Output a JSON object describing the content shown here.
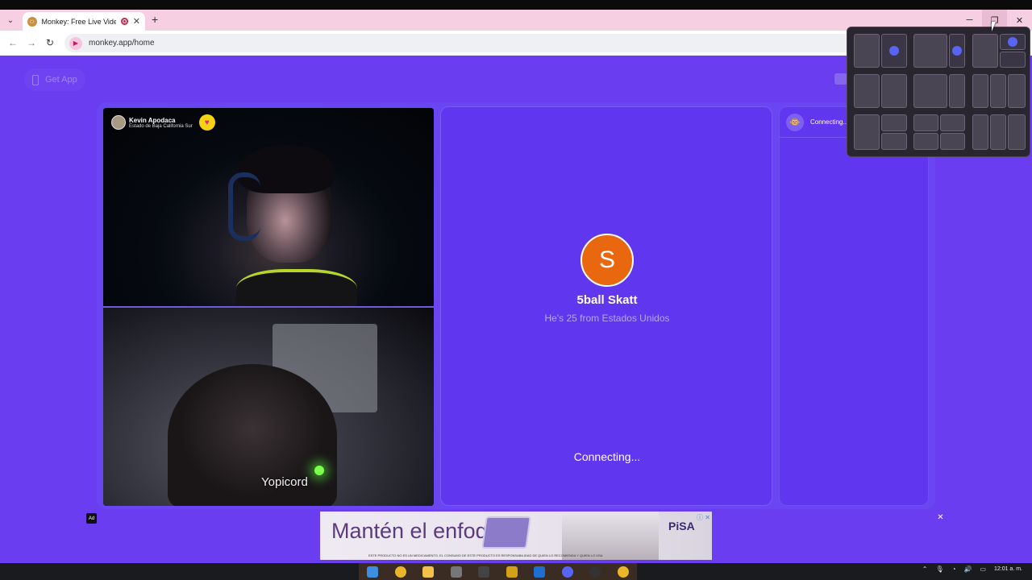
{
  "browser": {
    "tab_title": "Monkey: Free Live Video Chat",
    "tab_favicon": "monkey-icon",
    "url": "monkey.app/home",
    "new_tab": "+",
    "tab_close": "✕",
    "win_minimize": "─",
    "win_restore": "❐",
    "win_close": "✕"
  },
  "page": {
    "get_app_label": "Get App",
    "local_user": {
      "name": "Kevin Apodaca",
      "location": "Estado de Baja California Sur"
    },
    "remote_watermark": "Yopicord",
    "match": {
      "avatar_letter": "S",
      "name": "5ball Skatt",
      "subtitle": "He's 25 from Estados Unidos",
      "status": "Connecting..."
    },
    "chat": {
      "status": "Connecting..."
    }
  },
  "ad": {
    "tag": "Ad",
    "headline": "Mantén el enfoque",
    "brand": "PiSA",
    "disclaimer": "ESTE PRODUCTO NO ES UN MEDICAMENTO. EL CONSUMO DE ESTE PRODUCTO ES RESPONSABILIDAD DE QUIEN LO RECOMIENDA Y QUIEN LO USA",
    "close": "✕"
  },
  "taskbar": {
    "time": "12:01 a. m."
  },
  "colors": {
    "page_bg": "#6a3df0",
    "card_bg": "#6037ee",
    "avatar_orange": "#e8670f",
    "tab_strip": "#f6cfe3"
  }
}
